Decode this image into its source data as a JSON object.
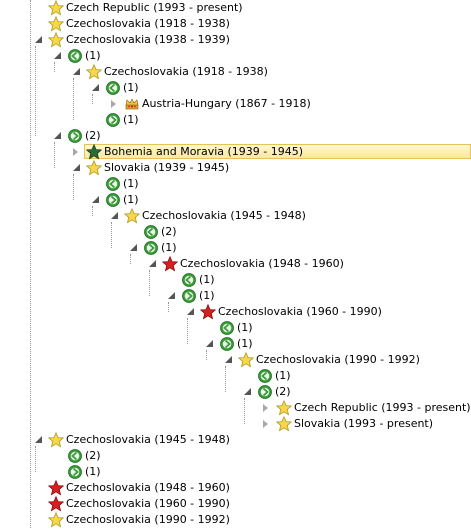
{
  "tree_nodes": [
    {
      "label": "Czech Republic (1993 - present)",
      "icon": "star-yellow",
      "expander": "none",
      "indent": 0
    },
    {
      "label": "Czechoslovakia (1918 - 1938)",
      "icon": "star-yellow",
      "expander": "none",
      "indent": 0
    },
    {
      "label": "Czechoslovakia (1938 - 1939)",
      "icon": "star-yellow",
      "expander": "open",
      "indent": 0
    },
    {
      "label": "(1)",
      "icon": "arrow-left-green",
      "expander": "open",
      "indent": 1
    },
    {
      "label": "Czechoslovakia (1918 - 1938)",
      "icon": "star-yellow",
      "expander": "open",
      "indent": 2
    },
    {
      "label": "(1)",
      "icon": "arrow-left-green",
      "expander": "open",
      "indent": 3
    },
    {
      "label": "Austria-Hungary (1867 - 1918)",
      "icon": "crown",
      "expander": "closed",
      "indent": 4
    },
    {
      "label": "(1)",
      "icon": "arrow-right-green",
      "expander": "none",
      "indent": 3
    },
    {
      "label": "(2)",
      "icon": "arrow-right-green",
      "expander": "open",
      "indent": 1
    },
    {
      "label": "Bohemia and Moravia (1939 - 1945)",
      "icon": "star-dark-green",
      "expander": "closed",
      "indent": 2,
      "selected": true
    },
    {
      "label": "Slovakia (1939 - 1945)",
      "icon": "star-yellow",
      "expander": "open",
      "indent": 2
    },
    {
      "label": "(1)",
      "icon": "arrow-left-green",
      "expander": "none",
      "indent": 3
    },
    {
      "label": "(1)",
      "icon": "arrow-right-green",
      "expander": "open",
      "indent": 3
    },
    {
      "label": "Czechoslovakia (1945 - 1948)",
      "icon": "star-yellow",
      "expander": "open",
      "indent": 4
    },
    {
      "label": "(2)",
      "icon": "arrow-left-green",
      "expander": "none",
      "indent": 5
    },
    {
      "label": "(1)",
      "icon": "arrow-right-green",
      "expander": "open",
      "indent": 5
    },
    {
      "label": "Czechoslovakia (1948 - 1960)",
      "icon": "star-red",
      "expander": "open",
      "indent": 6
    },
    {
      "label": "(1)",
      "icon": "arrow-left-green",
      "expander": "none",
      "indent": 7
    },
    {
      "label": "(1)",
      "icon": "arrow-right-green",
      "expander": "open",
      "indent": 7
    },
    {
      "label": "Czechoslovakia (1960 - 1990)",
      "icon": "star-red",
      "expander": "open",
      "indent": 8
    },
    {
      "label": "(1)",
      "icon": "arrow-left-green",
      "expander": "none",
      "indent": 9
    },
    {
      "label": "(1)",
      "icon": "arrow-right-green",
      "expander": "open",
      "indent": 9
    },
    {
      "label": "Czechoslovakia (1990 - 1992)",
      "icon": "star-yellow",
      "expander": "open",
      "indent": 10
    },
    {
      "label": "(1)",
      "icon": "arrow-left-green",
      "expander": "none",
      "indent": 11
    },
    {
      "label": "(2)",
      "icon": "arrow-right-green",
      "expander": "open",
      "indent": 11
    },
    {
      "label": "Czech Republic (1993 - present)",
      "icon": "star-yellow",
      "expander": "closed",
      "indent": 12
    },
    {
      "label": "Slovakia (1993 - present)",
      "icon": "star-yellow",
      "expander": "closed",
      "indent": 12
    },
    {
      "label": "Czechoslovakia (1945 - 1948)",
      "icon": "star-yellow",
      "expander": "open",
      "indent": 0
    },
    {
      "label": "(2)",
      "icon": "arrow-left-green",
      "expander": "none",
      "indent": 1
    },
    {
      "label": "(1)",
      "icon": "arrow-right-green",
      "expander": "none",
      "indent": 1
    },
    {
      "label": "Czechoslovakia (1948 - 1960)",
      "icon": "star-red",
      "expander": "none",
      "indent": 0
    },
    {
      "label": "Czechoslovakia (1960 - 1990)",
      "icon": "star-red",
      "expander": "none",
      "indent": 0
    },
    {
      "label": "Czechoslovakia (1990 - 1992)",
      "icon": "star-yellow",
      "expander": "none",
      "indent": 0
    }
  ],
  "colors": {
    "star_yellow": "#f6d64a",
    "star_red": "#d81e1e",
    "star_dark_green": "#2f6b2f",
    "arrow_green": "#3a9a3a",
    "selection": "#fde89a"
  }
}
